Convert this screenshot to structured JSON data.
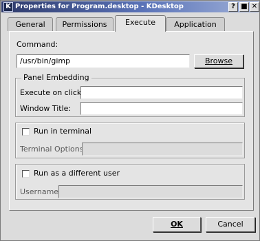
{
  "window": {
    "title": "Properties for Program.desktop - KDesktop",
    "app_icon_letter": "K",
    "help_glyph": "?",
    "minimize_glyph": "■",
    "close_glyph": "✕"
  },
  "tabs": [
    {
      "label": "General",
      "active": false
    },
    {
      "label": "Permissions",
      "active": false
    },
    {
      "label": "Execute",
      "active": true
    },
    {
      "label": "Application",
      "active": false
    }
  ],
  "command": {
    "label": "Command:",
    "value": "/usr/bin/gimp",
    "browse_label": "Browse"
  },
  "panel_embedding": {
    "title": "Panel Embedding",
    "execute_on_click_label": "Execute on click:",
    "execute_on_click_value": "",
    "window_title_label": "Window Title:",
    "window_title_value": ""
  },
  "terminal": {
    "checkbox_label": "Run in terminal",
    "checked": false,
    "options_label": "Terminal Options",
    "options_value": ""
  },
  "user": {
    "checkbox_label": "Run as a different user",
    "checked": false,
    "username_label": "Username",
    "username_value": ""
  },
  "buttons": {
    "ok_label": "OK",
    "cancel_label": "Cancel"
  }
}
